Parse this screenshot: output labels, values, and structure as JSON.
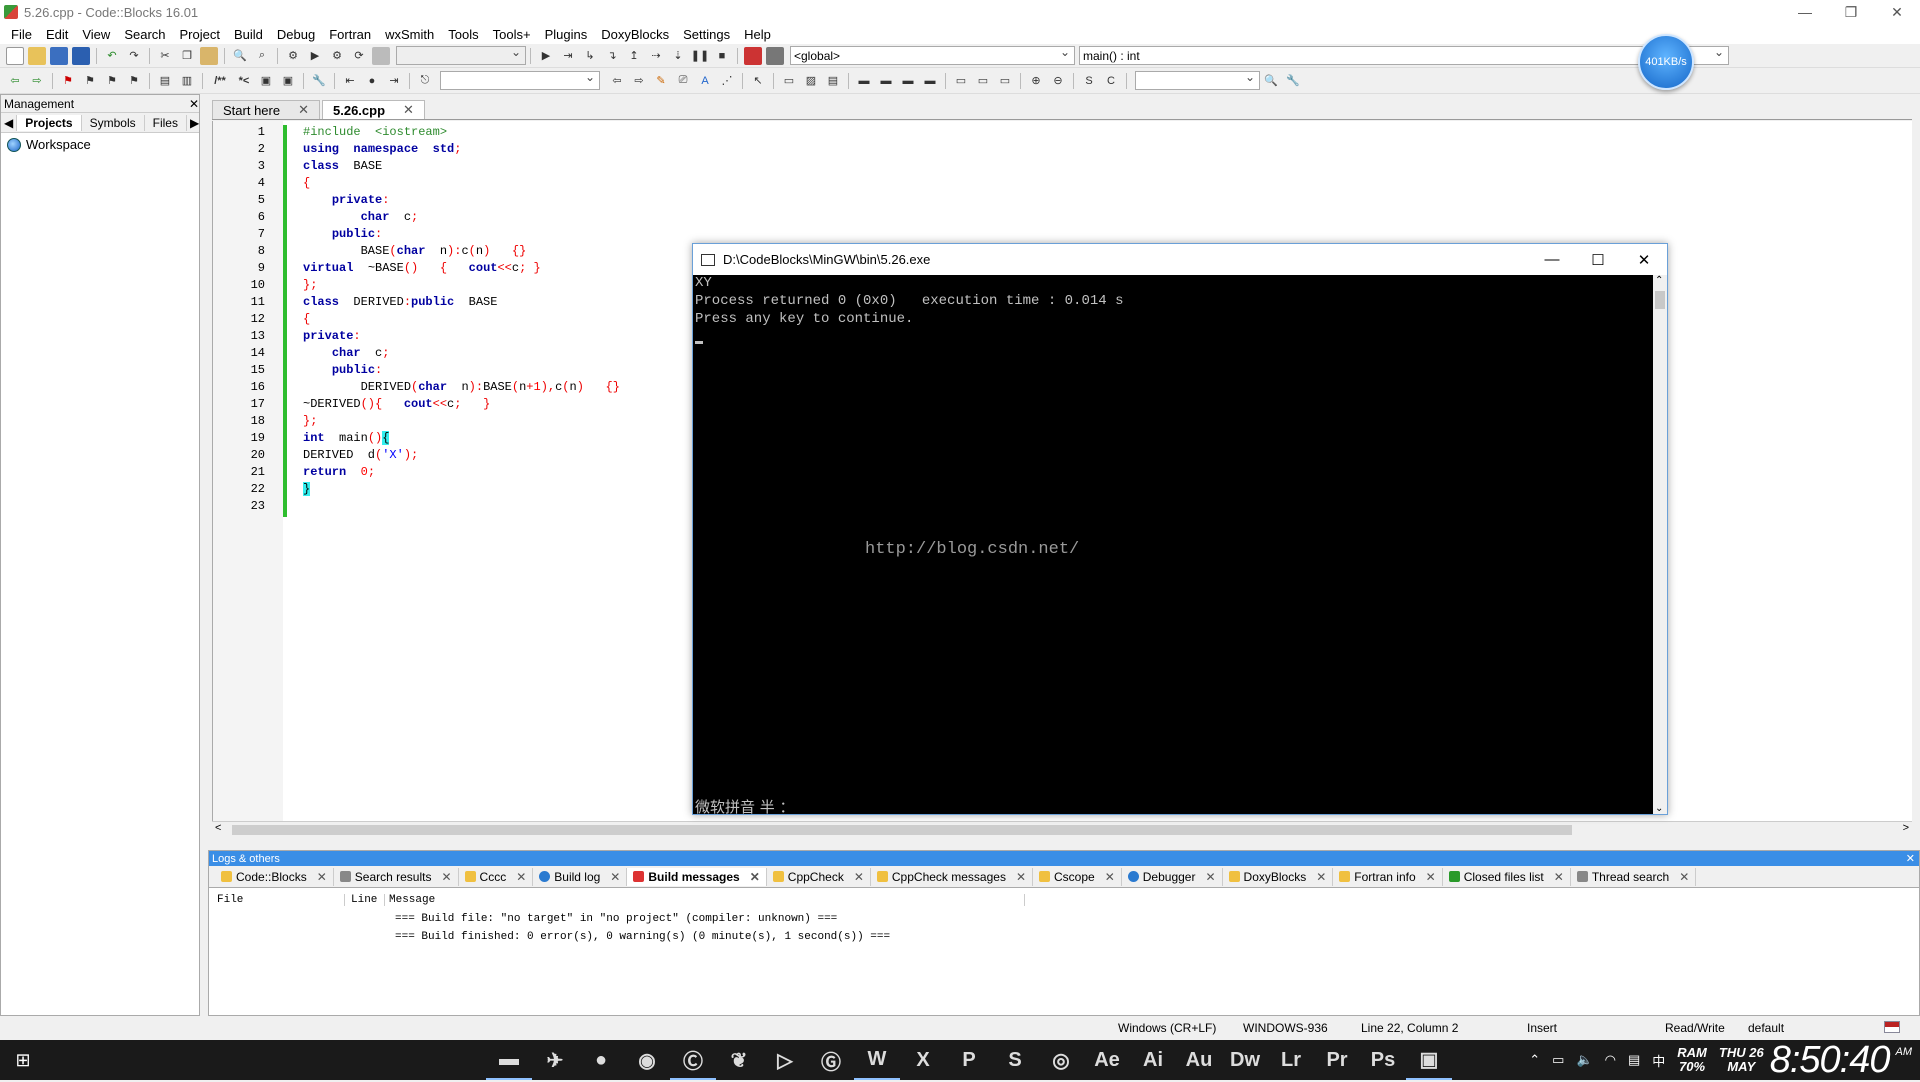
{
  "window": {
    "title": "5.26.cpp - Code::Blocks 16.01"
  },
  "menu": [
    "File",
    "Edit",
    "View",
    "Search",
    "Project",
    "Build",
    "Debug",
    "Fortran",
    "wxSmith",
    "Tools",
    "Tools+",
    "Plugins",
    "DoxyBlocks",
    "Settings",
    "Help"
  ],
  "toolbar": {
    "scope_combo": "<global>",
    "function_combo": "main() : int",
    "net_speed": "401KB/s",
    "toggle_comment": "/**",
    "toggle_uncomment": "*<"
  },
  "management": {
    "title": "Management",
    "tabs": [
      "Projects",
      "Symbols",
      "Files"
    ],
    "workspace": "Workspace"
  },
  "editor": {
    "tabs": [
      {
        "label": "Start here"
      },
      {
        "label": "5.26.cpp"
      }
    ],
    "line_numbers": [
      "1",
      "2",
      "3",
      "4",
      "5",
      "6",
      "7",
      "8",
      "9",
      "10",
      "11",
      "12",
      "13",
      "14",
      "15",
      "16",
      "17",
      "18",
      "19",
      "20",
      "21",
      "22",
      "23"
    ]
  },
  "console": {
    "title": "D:\\CodeBlocks\\MinGW\\bin\\5.26.exe",
    "lines": [
      "XY",
      "Process returned 0 (0x0)   execution time : 0.014 s",
      "Press any key to continue."
    ],
    "ime": "微软拼音 半 ："
  },
  "watermark": "http://blog.csdn.net/",
  "logs": {
    "title": "Logs & others",
    "tabs": [
      "Code::Blocks",
      "Search results",
      "Cccc",
      "Build log",
      "Build messages",
      "CppCheck",
      "CppCheck messages",
      "Cscope",
      "Debugger",
      "DoxyBlocks",
      "Fortran info",
      "Closed files list",
      "Thread search"
    ],
    "columns": [
      "File",
      "Line",
      "Message"
    ],
    "messages": [
      "=== Build file: \"no target\" in \"no project\" (compiler: unknown) ===",
      "=== Build finished: 0 error(s), 0 warning(s) (0 minute(s), 1 second(s)) ==="
    ]
  },
  "status": {
    "eol": "Windows (CR+LF)",
    "encoding": "WINDOWS-936",
    "position": "Line 22, Column 2",
    "mode": "Insert",
    "access": "Read/Write",
    "profile": "default"
  },
  "taskbar": {
    "apps": [
      "Ae",
      "Ai",
      "Au",
      "Dw",
      "Lr",
      "Pr",
      "Ps"
    ],
    "ram_label": "RAM",
    "ram_value": "70%",
    "day": "THU",
    "date": "26",
    "month": "MAY",
    "time": "8:50:40",
    "ampm": "AM",
    "ime": "中"
  }
}
